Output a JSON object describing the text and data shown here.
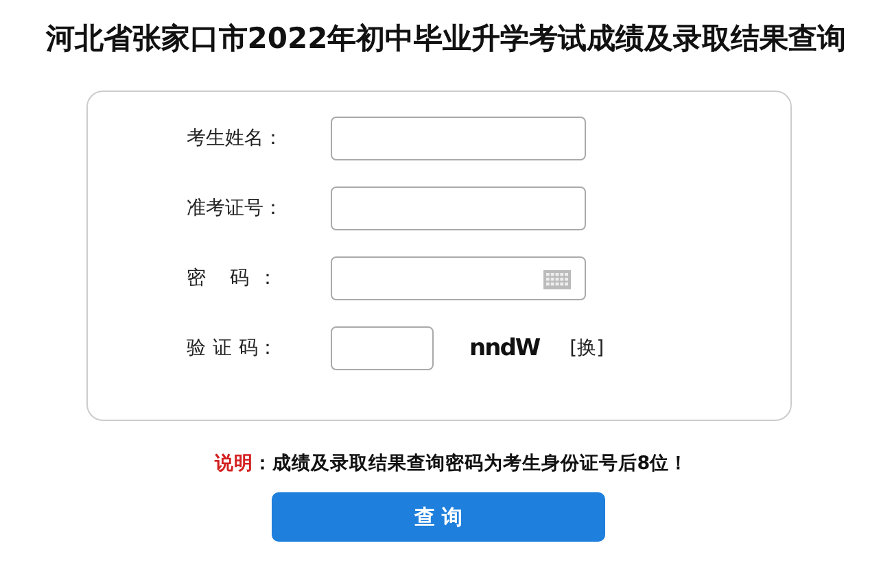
{
  "title": "河北省张家口市2022年初中毕业升学考试成绩及录取结果查询",
  "form": {
    "fields": [
      {
        "kind": "text",
        "label": "考生姓名："
      },
      {
        "kind": "text",
        "label": "准考证号："
      },
      {
        "kind": "password",
        "label": "密 码："
      },
      {
        "kind": "captcha",
        "label": "验 证 码：",
        "captcha": "nndW",
        "refresh": "[换]"
      }
    ]
  },
  "note": {
    "label": "说明",
    "text": "：成绩及录取结果查询密码为考生身份证号后8位！"
  },
  "buttons": [
    "查 询"
  ]
}
